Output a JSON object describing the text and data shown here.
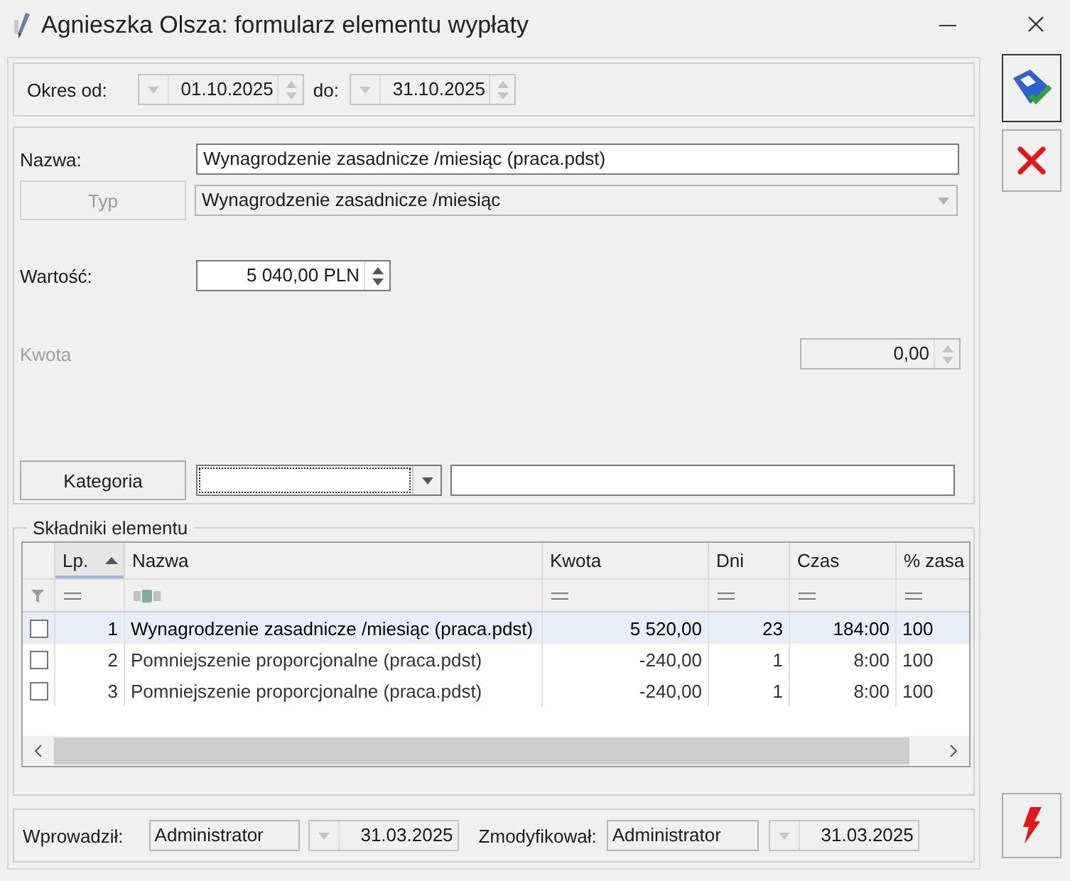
{
  "window": {
    "title": "Agnieszka Olsza: formularz elementu wypłaty"
  },
  "period": {
    "from_label": "Okres od:",
    "from": "01.10.2025",
    "to_label": "do:",
    "to": "31.10.2025"
  },
  "form": {
    "name_label": "Nazwa:",
    "name_value": "Wynagrodzenie zasadnicze /miesiąc (praca.pdst)",
    "type_button": {
      "label": "Typ",
      "disabled": true
    },
    "type_value": "Wynagrodzenie zasadnicze /miesiąc",
    "value_label": "Wartość:",
    "value": "5 040,00 PLN",
    "amount": {
      "label": "Kwota",
      "value": "0,00",
      "disabled": true
    },
    "category_button": {
      "label": "Kategoria"
    }
  },
  "components": {
    "title": "Składniki elementu",
    "columns": [
      {
        "label": "Lp.",
        "sorted": true,
        "kind": "number"
      },
      {
        "label": "Nazwa",
        "sorted": false,
        "kind": "text"
      },
      {
        "label": "Kwota",
        "sorted": false,
        "kind": "number"
      },
      {
        "label": "Dni",
        "sorted": false,
        "kind": "number"
      },
      {
        "label": "Czas",
        "sorted": false,
        "kind": "number"
      },
      {
        "label": "% zasa",
        "sorted": false,
        "kind": "number"
      }
    ],
    "rows": [
      {
        "checked": false,
        "selected": true,
        "cells": [
          "1",
          "Wynagrodzenie zasadnicze /miesiąc (praca.pdst)",
          "5 520,00",
          "23",
          "184:00",
          "100"
        ]
      },
      {
        "checked": false,
        "selected": false,
        "cells": [
          "2",
          "Pomniejszenie proporcjonalne (praca.pdst)",
          "-240,00",
          "1",
          "8:00",
          "100"
        ]
      },
      {
        "checked": false,
        "selected": false,
        "cells": [
          "3",
          "Pomniejszenie proporcjonalne (praca.pdst)",
          "-240,00",
          "1",
          "8:00",
          "100"
        ]
      }
    ]
  },
  "footer": {
    "entered_label": "Wprowadził:",
    "entered_by": "Administrator",
    "entered_date": "31.03.2025",
    "modified_label": "Zmodyfikował:",
    "modified_by": "Administrator",
    "modified_date": "31.03.2025"
  }
}
